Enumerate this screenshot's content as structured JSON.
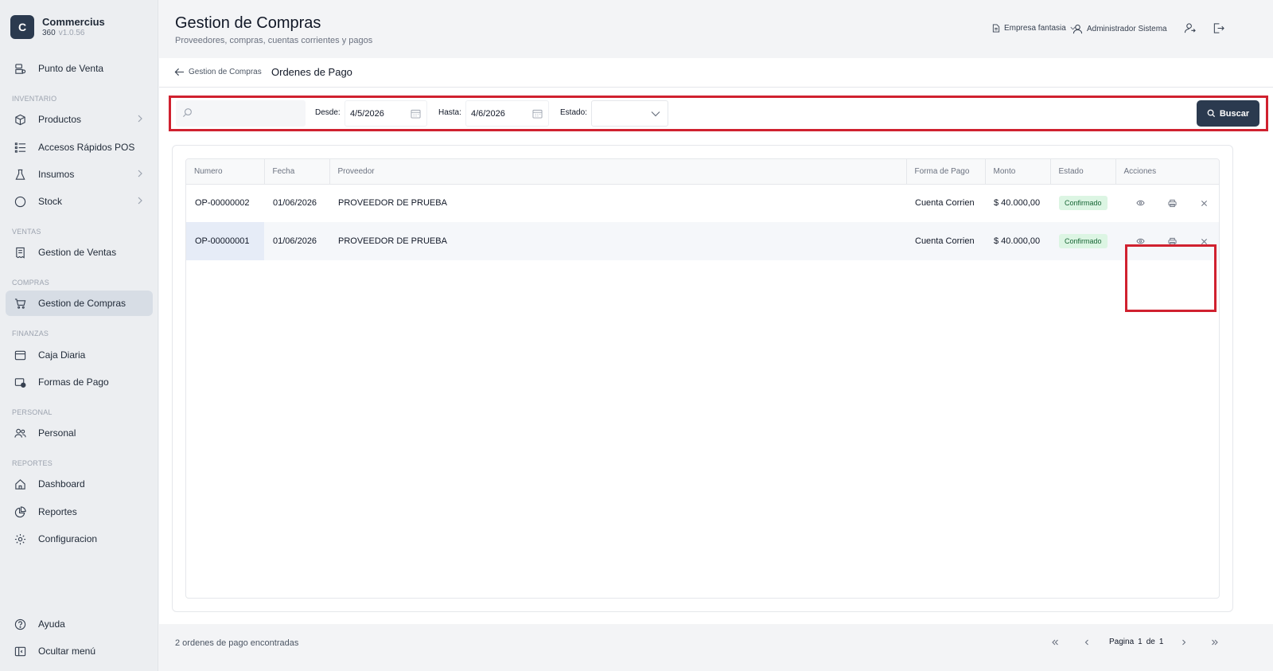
{
  "brand": {
    "logo_letter": "C",
    "name": "Commercius",
    "product": "360",
    "version": "v1.0.56"
  },
  "sidebar": {
    "items": [
      {
        "label": "Punto de Venta",
        "icon": "pos-terminal-icon"
      },
      {
        "label": "Productos",
        "icon": "box-icon"
      },
      {
        "label": "Accesos Rápidos POS",
        "icon": "list-icon"
      },
      {
        "label": "Insumos",
        "icon": "flask-icon"
      },
      {
        "label": "Stock",
        "icon": "circle-icon"
      },
      {
        "label": "Gestion de Ventas",
        "icon": "receipt-icon"
      },
      {
        "label": "Gestion de Compras",
        "icon": "cart-icon"
      },
      {
        "label": "Caja Diaria",
        "icon": "cash-register-icon"
      },
      {
        "label": "Formas de Pago",
        "icon": "wallet-icon"
      },
      {
        "label": "Personal",
        "icon": "users-icon"
      },
      {
        "label": "Dashboard",
        "icon": "home-icon"
      },
      {
        "label": "Reportes",
        "icon": "chart-pie-icon"
      },
      {
        "label": "Configuracion",
        "icon": "gear-icon"
      },
      {
        "label": "Ayuda",
        "icon": "help-circle-icon"
      },
      {
        "label": "Ocultar menú",
        "icon": "collapse-sidebar-icon"
      }
    ],
    "sections": [
      "INVENTARIO",
      "VENTAS",
      "COMPRAS",
      "FINANZAS",
      "PERSONAL",
      "REPORTES"
    ]
  },
  "header": {
    "title": "Gestion de Compras",
    "subtitle": "Proveedores, compras, cuentas corrientes y pagos",
    "company": "Empresa fantasia",
    "user": "Administrador Sistema"
  },
  "breadcrumb": {
    "back": "Gestion de Compras",
    "current": "Ordenes de Pago"
  },
  "filters": {
    "search_placeholder": "",
    "desde_label": "Desde:",
    "desde_value": "4/5/2026",
    "hasta_label": "Hasta:",
    "hasta_value": "4/6/2026",
    "estado_label": "Estado:",
    "estado_value": "",
    "buscar_label": "Buscar"
  },
  "table": {
    "columns": [
      "Numero",
      "Fecha",
      "Proveedor",
      "Forma de Pago",
      "Monto",
      "Estado",
      "Acciones"
    ],
    "rows": [
      {
        "numero": "OP-00000002",
        "fecha": "01/06/2026",
        "proveedor": "PROVEEDOR DE PRUEBA",
        "forma": "Cuenta Corrien",
        "monto": "$ 40.000,00",
        "estado": "Confirmado"
      },
      {
        "numero": "OP-00000001",
        "fecha": "01/06/2026",
        "proveedor": "PROVEEDOR DE PRUEBA",
        "forma": "Cuenta Corrien",
        "monto": "$ 40.000,00",
        "estado": "Confirmado"
      }
    ]
  },
  "footer": {
    "count": "2 ordenes de pago encontradas",
    "page_label": "Pagina",
    "page_current": "1",
    "page_of": "de",
    "page_total": "1"
  },
  "colors": {
    "primary": "#2b3a4f",
    "highlight": "#d0212f",
    "badge_bg": "#dcf5e3",
    "badge_text": "#166534"
  }
}
